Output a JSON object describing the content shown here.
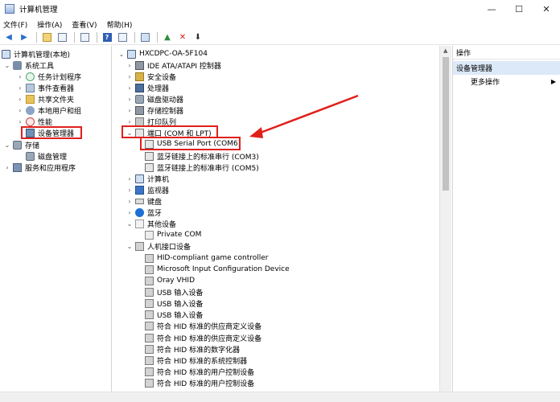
{
  "window": {
    "title": "计算机管理",
    "controls": [
      "—",
      "☐",
      "✕"
    ]
  },
  "menu": [
    "文件(F)",
    "操作(A)",
    "查看(V)",
    "帮助(H)"
  ],
  "left_tree": {
    "root": "计算机管理(本地)",
    "system_tools": "系统工具",
    "task_scheduler": "任务计划程序",
    "event_viewer": "事件查看器",
    "shared_folders": "共享文件夹",
    "local_users": "本地用户和组",
    "performance": "性能",
    "device_manager": "设备管理器",
    "storage": "存储",
    "disk_management": "磁盘管理",
    "services_apps": "服务和应用程序"
  },
  "devices": {
    "root": "HXCDPC-OA-5F104",
    "categories_top": [
      "IDE ATA/ATAPI 控制器",
      "安全设备",
      "处理器",
      "磁盘驱动器",
      "存储控制器",
      "打印队列"
    ],
    "ports_label": "端口 (COM 和 LPT)",
    "ports": [
      "USB Serial Port (COM6)",
      "蓝牙链接上的标准串行 (COM3)",
      "蓝牙链接上的标准串行 (COM5)"
    ],
    "categories_mid": [
      "计算机",
      "监视器",
      "键盘",
      "蓝牙"
    ],
    "other_label": "其他设备",
    "other_items": [
      "Private COM"
    ],
    "hid_label": "人机接口设备",
    "hid_items": [
      "HID-compliant game controller",
      "Microsoft Input Configuration Device",
      "Oray VHID",
      "USB 输入设备",
      "USB 输入设备",
      "USB 输入设备",
      "符合 HID 标准的供应商定义设备",
      "符合 HID 标准的供应商定义设备",
      "符合 HID 标准的数字化器",
      "符合 HID 标准的系统控制器",
      "符合 HID 标准的用户控制设备",
      "符合 HID 标准的用户控制设备"
    ]
  },
  "actions": {
    "header": "操作",
    "selected": "设备管理器",
    "more": "更多操作"
  },
  "colors": {
    "highlight": "#e0201b",
    "selection": "#dbe9f8"
  }
}
